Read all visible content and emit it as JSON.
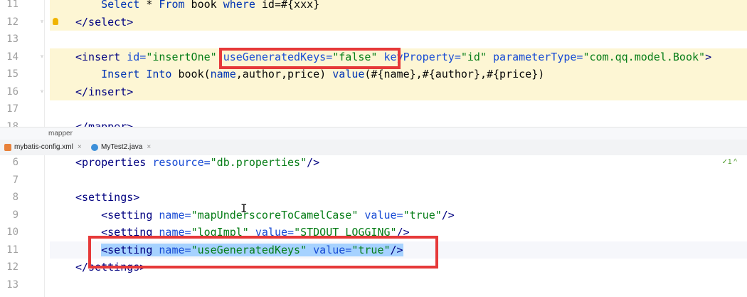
{
  "top_editor": {
    "lines": [
      {
        "num": "11",
        "tokens": [
          {
            "t": "    ",
            "c": "plain"
          },
          {
            "t": "Select",
            "c": "kw"
          },
          {
            "t": " * ",
            "c": "plain"
          },
          {
            "t": "From",
            "c": "kw"
          },
          {
            "t": " book ",
            "c": "plain"
          },
          {
            "t": "where",
            "c": "kw"
          },
          {
            "t": " id=#{xxx}",
            "c": "plain"
          }
        ]
      },
      {
        "num": "12",
        "tokens": [
          {
            "t": "</select>",
            "c": "tag"
          }
        ]
      },
      {
        "num": "13",
        "tokens": []
      },
      {
        "num": "14",
        "tokens": [
          {
            "t": "<insert ",
            "c": "tag"
          },
          {
            "t": "id=",
            "c": "attr"
          },
          {
            "t": "\"insertOne\"",
            "c": "val"
          },
          {
            "t": " ",
            "c": "plain"
          },
          {
            "t": "useGeneratedKeys=",
            "c": "attr"
          },
          {
            "t": "\"false\"",
            "c": "val"
          },
          {
            "t": " ",
            "c": "plain"
          },
          {
            "t": "keyProperty=",
            "c": "attr"
          },
          {
            "t": "\"id\"",
            "c": "val"
          },
          {
            "t": " ",
            "c": "plain"
          },
          {
            "t": "parameterType=",
            "c": "attr"
          },
          {
            "t": "\"com.qq.model.Book\"",
            "c": "val"
          },
          {
            "t": ">",
            "c": "tag"
          }
        ]
      },
      {
        "num": "15",
        "tokens": [
          {
            "t": "    ",
            "c": "plain"
          },
          {
            "t": "Insert",
            "c": "kw"
          },
          {
            "t": " ",
            "c": "plain"
          },
          {
            "t": "Into",
            "c": "kw"
          },
          {
            "t": " book(",
            "c": "plain"
          },
          {
            "t": "name",
            "c": "kw"
          },
          {
            "t": ",author,price) ",
            "c": "plain"
          },
          {
            "t": "value",
            "c": "kw"
          },
          {
            "t": "(#{name},#{author},#{price})",
            "c": "plain"
          }
        ]
      },
      {
        "num": "16",
        "tokens": [
          {
            "t": "</insert>",
            "c": "tag"
          }
        ]
      },
      {
        "num": "17",
        "tokens": []
      },
      {
        "num": "18",
        "tokens": [
          {
            "t": "</mapper>",
            "c": "tag"
          }
        ]
      }
    ]
  },
  "breadcrumb": {
    "text": "mapper"
  },
  "tabs": [
    {
      "label": "mybatis-config.xml",
      "close": "×",
      "icon": "xml-file-icon",
      "active": true
    },
    {
      "label": "MyTest2.java",
      "close": "×",
      "icon": "java-class-icon",
      "active": false
    }
  ],
  "inspection": {
    "text": "✓1 ^"
  },
  "bottom_editor": {
    "lines": [
      {
        "num": "6",
        "tokens": [
          {
            "t": "<properties ",
            "c": "tag"
          },
          {
            "t": "resource=",
            "c": "attr"
          },
          {
            "t": "\"db.properties\"",
            "c": "val"
          },
          {
            "t": "/>",
            "c": "tag"
          }
        ]
      },
      {
        "num": "7",
        "tokens": []
      },
      {
        "num": "8",
        "tokens": [
          {
            "t": "<settings>",
            "c": "tag"
          }
        ]
      },
      {
        "num": "9",
        "tokens": [
          {
            "t": "    ",
            "c": "plain"
          },
          {
            "t": "<setting ",
            "c": "tag"
          },
          {
            "t": "name=",
            "c": "attr"
          },
          {
            "t": "\"mapUnderscoreToCamelCase\"",
            "c": "val"
          },
          {
            "t": " ",
            "c": "plain"
          },
          {
            "t": "value=",
            "c": "attr"
          },
          {
            "t": "\"true\"",
            "c": "val"
          },
          {
            "t": "/>",
            "c": "tag"
          }
        ]
      },
      {
        "num": "10",
        "tokens": [
          {
            "t": "    ",
            "c": "plain"
          },
          {
            "t": "<setting ",
            "c": "tag"
          },
          {
            "t": "name=",
            "c": "attr"
          },
          {
            "t": "\"logImpl\"",
            "c": "val"
          },
          {
            "t": " ",
            "c": "plain"
          },
          {
            "t": "value=",
            "c": "attr"
          },
          {
            "t": "\"STDOUT_LOGGING\"",
            "c": "val"
          },
          {
            "t": "/>",
            "c": "tag"
          }
        ]
      },
      {
        "num": "11",
        "tokens": [
          {
            "t": "    ",
            "c": "plain"
          },
          {
            "t": "<setting ",
            "c": "tag",
            "sel": true
          },
          {
            "t": "name=",
            "c": "attr",
            "sel": true
          },
          {
            "t": "\"useGeneratedKeys\"",
            "c": "val",
            "sel": true
          },
          {
            "t": " ",
            "c": "plain",
            "sel": true
          },
          {
            "t": "value=",
            "c": "attr",
            "sel": true
          },
          {
            "t": "\"true\"",
            "c": "val",
            "sel": true
          },
          {
            "t": "/>",
            "c": "tag",
            "sel": true
          }
        ]
      },
      {
        "num": "12",
        "tokens": [
          {
            "t": "</settings>",
            "c": "tag"
          }
        ]
      },
      {
        "num": "13",
        "tokens": []
      }
    ]
  },
  "colors": {
    "highlight_box": "#e63939",
    "selection": "#a6d2ff",
    "current_block": "#fdf6d4"
  }
}
